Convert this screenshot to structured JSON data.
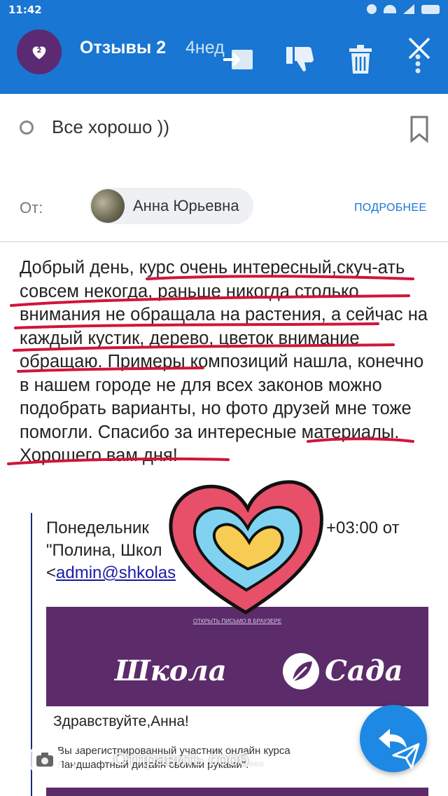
{
  "status_bar": {
    "time": "11:42"
  },
  "app_bar": {
    "badge_count": "2",
    "title": "Отзывы 2",
    "age": "4нед",
    "actions": [
      "move-to-icon",
      "thumbs-down-icon",
      "trash-icon",
      "close-icon"
    ]
  },
  "message": {
    "subject": "Все хорошо ))",
    "from_label": "От:",
    "sender_name": "Анна Юрьевна",
    "details_link": "ПОДРОБНЕЕ",
    "body": "Добрый день, курс очень интересный,скуч-ать совсем некогда, раньше никогда столько внимания не обращала на растения, а сейчас на каждый кустик, дерево, цветок внимание обращаю. Примеры композиций нашла, конечно в нашем городе не для всех законов можно подобрать варианты, но фото друзей мне тоже помогли. Спасибо за интересные материалы. Хорошего вам дня!"
  },
  "quote": {
    "line1": "Понедельник",
    "line1_right": "+03:00 от",
    "line2": "\"Полина, Школ",
    "email": "admin@shkolas",
    "open_in_browser": "ОТКРЫТЬ ПИСЬМО В БРАУЗЕРЕ",
    "brand_left": "Школа",
    "brand_right": "Сада",
    "greeting": "Здравствуйте,Анна!",
    "fine_print": "Вы зарегистрированный участник онлайн курса Ландшафтный дизайн своими руками\"."
  },
  "compose": {
    "placeholder": "Отправить сооб..."
  },
  "colors": {
    "app_bar": "#1976d2",
    "accent_link": "#1976d2",
    "underline_marks": "#d0153a",
    "banner": "#5b2b6a"
  }
}
